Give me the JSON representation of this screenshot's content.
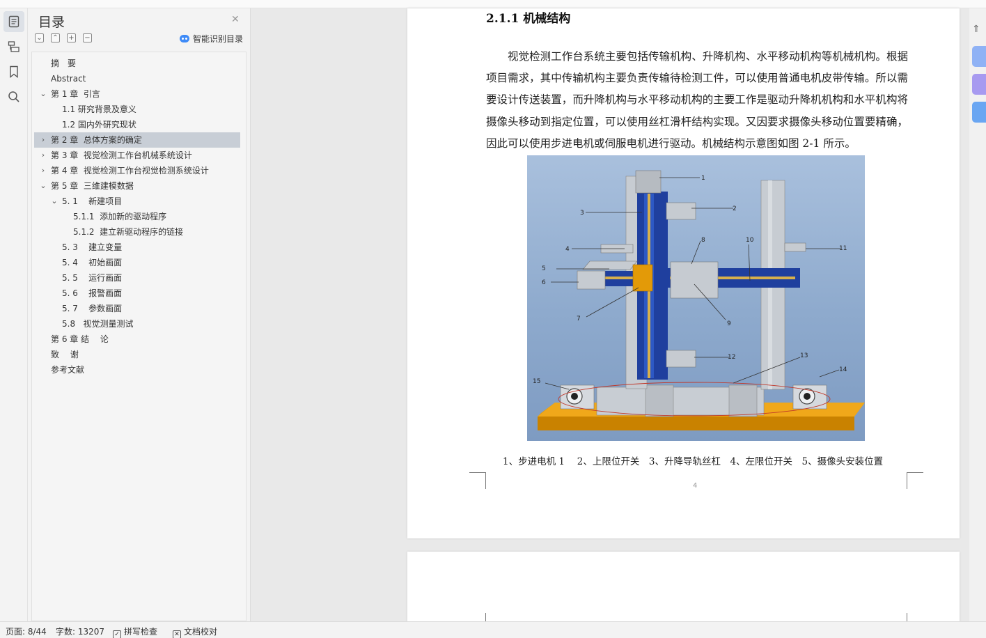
{
  "toc": {
    "title": "目录",
    "ai_button": "智能识别目录",
    "items": [
      {
        "label": "摘　要"
      },
      {
        "label": "Abstract"
      },
      {
        "label": "第 1 章  引言"
      },
      {
        "label": "1.1 研究背景及意义"
      },
      {
        "label": "1.2 国内外研究现状"
      },
      {
        "label": "第 2 章  总体方案的确定"
      },
      {
        "label": "第 3 章  视觉检测工作台机械系统设计"
      },
      {
        "label": "第 4 章  视觉检测工作台视觉检测系统设计"
      },
      {
        "label": "第 5 章  三维建模数据"
      },
      {
        "label": "5. 1    新建项目"
      },
      {
        "label": "5.1.1  添加新的驱动程序"
      },
      {
        "label": "5.1.2  建立新驱动程序的链接"
      },
      {
        "label": "5. 3    建立变量"
      },
      {
        "label": "5. 4    初始画面"
      },
      {
        "label": "5. 5    运行画面"
      },
      {
        "label": "5. 6    报警画面"
      },
      {
        "label": "5. 7    参数画面"
      },
      {
        "label": "5.8   视觉测量测试"
      },
      {
        "label": "第 6 章 结　 论"
      },
      {
        "label": "致　 谢"
      },
      {
        "label": "参考文献"
      }
    ]
  },
  "document": {
    "heading": "2.1.1 机械结构",
    "paragraph": "视觉检测工作台系统主要包括传输机构、升降机构、水平移动机构等机械机构。根据项目需求，其中传输机构主要负责传输待检测工件，可以使用普通电机皮带传输。所以需要设计传送装置，而升降机构与水平移动机构的主要工作是驱动升降机机构和水平机构将摄像头移动到指定位置，可以使用丝杠滑杆结构实现。又因要求摄像头移动位置要精确，因此可以使用步进电机或伺服电机进行驱动。机械结构示意图如图 2-1 所示。",
    "figure_labels": [
      "1",
      "2",
      "3",
      "4",
      "5",
      "6",
      "7",
      "8",
      "9",
      "10",
      "11",
      "12",
      "13",
      "14",
      "15"
    ],
    "caption": "1、步进电机 1　 2、上限位开关　3、升降导轨丝杠　4、左限位开关　5、摄像头安装位置",
    "page_number": "4"
  },
  "status": {
    "page": "页面: 8/44",
    "words": "字数: 13207",
    "spell_check": "拼写检查",
    "proofread": "文档校对"
  },
  "colors": {
    "selected_row": "#c8ced6",
    "figure_blue": "#1f3f9e",
    "figure_orange": "#e39a08",
    "ai_blue": "#3d8af7",
    "right_buttons": [
      "#8fb2f5",
      "#a79af0",
      "#6aa6f2"
    ]
  },
  "icons": [
    "toc-icon",
    "outline-icon",
    "bookmark-icon",
    "search-icon",
    "close-icon",
    "collapse-all-icon",
    "expand-all-icon",
    "add-icon",
    "remove-icon",
    "ai-icon",
    "checkbox-icon",
    "proofread-icon"
  ]
}
